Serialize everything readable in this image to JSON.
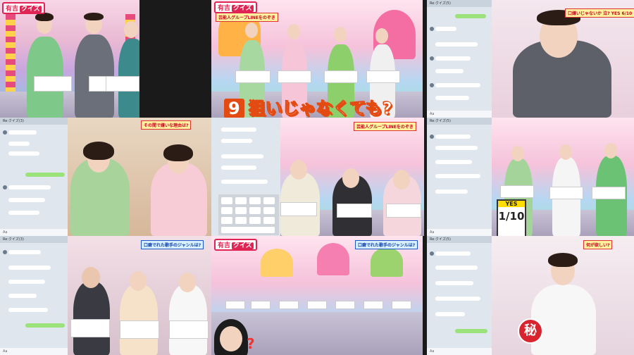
{
  "show": {
    "logo_main": "有吉",
    "logo_quiz": "クイズ"
  },
  "question": {
    "number": "9",
    "text": "狙いじゃなくても?"
  },
  "captions": {
    "secret_group": "芸能人グループLINEをのぞき",
    "group_line": "芸能人グループLINEをのぞき",
    "why_bother": "その間で嫌いな理由は?",
    "yes_count": "1/10",
    "yes_label": "YES",
    "genre_q": "口癖でれた歌手のジャンルは?",
    "genre_q2": "口癖でれた歌手のジャンルは?",
    "top_right": "口嫌いじゃないか 泣? YES 6/10",
    "hoshii": "何が欲しい?",
    "seal": "秘"
  },
  "chat": {
    "title_a": "Re:クイズ(5)",
    "title_b": "Re:クイズ(3)",
    "footer_a": "Aa",
    "footer_b": "Aa"
  },
  "colors": {
    "banner_red": "#c02",
    "quiz_orange": "#e34b12",
    "chat_bg": "#dfe6ee",
    "chat_green": "#9be27a"
  }
}
